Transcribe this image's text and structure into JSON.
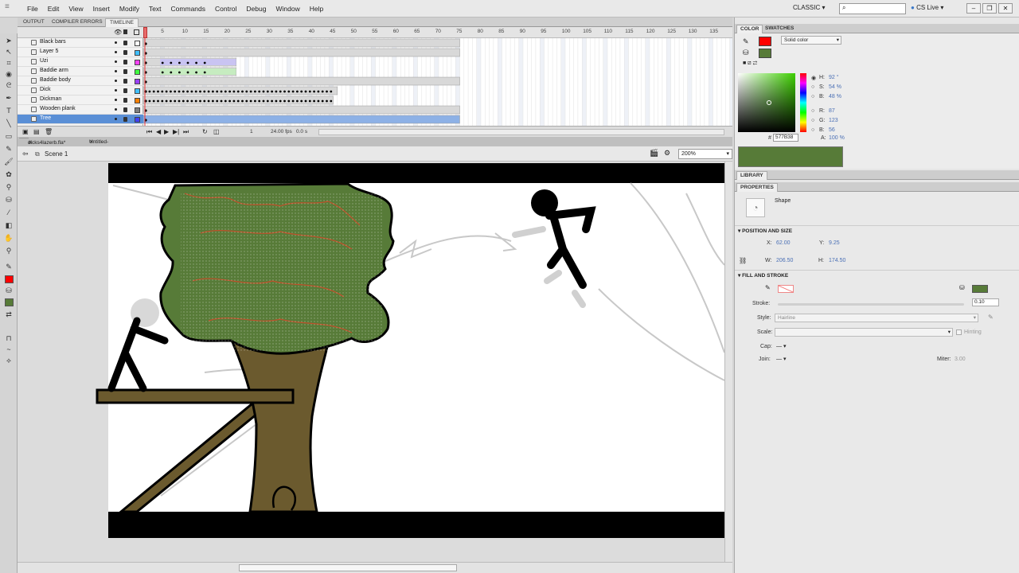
{
  "menu": {
    "items": [
      "File",
      "Edit",
      "View",
      "Insert",
      "Modify",
      "Text",
      "Commands",
      "Control",
      "Debug",
      "Window",
      "Help"
    ]
  },
  "workspace": "CLASSIC",
  "cs_live": "CS Live",
  "timeline_tabs": [
    "OUTPUT",
    "COMPILER ERRORS",
    "TIMELINE"
  ],
  "frame_numbers": [
    "1",
    "5",
    "10",
    "15",
    "20",
    "25",
    "30",
    "35",
    "40",
    "45",
    "50",
    "55",
    "60",
    "65",
    "70",
    "75",
    "80",
    "85",
    "90",
    "95",
    "100",
    "105",
    "110",
    "115",
    "120",
    "125",
    "130",
    "135"
  ],
  "layers": [
    {
      "name": "Black bars",
      "color": "#ffffff"
    },
    {
      "name": "Layer 5",
      "color": "#40c0ff"
    },
    {
      "name": "Uzi",
      "color": "#ff40ff"
    },
    {
      "name": "Baddie arm",
      "color": "#40ff40"
    },
    {
      "name": "Baddie body",
      "color": "#9a40ff"
    },
    {
      "name": "Dick",
      "color": "#40c0ff"
    },
    {
      "name": "Dickman",
      "color": "#ff8000"
    },
    {
      "name": "Wooden plank",
      "color": "#808080"
    },
    {
      "name": "Tree",
      "color": "#4040ff"
    }
  ],
  "timeline_footer": {
    "fps": "24.00 fps",
    "time": "0.0 s",
    "frame": "1"
  },
  "doc_tabs": [
    "dicks4lazerb.fla*",
    "Untitled-1*"
  ],
  "scene": "Scene 1",
  "zoom": "200%",
  "color_panel": {
    "tabs": [
      "COLOR",
      "SWATCHES"
    ],
    "type": "Solid color",
    "stroke_color": "#ff0000",
    "fill_color": "#577b38",
    "hue_label": "H:",
    "hue": "92 °",
    "sat_label": "S:",
    "sat": "54 %",
    "bri_label": "B:",
    "bri": "48 %",
    "r_label": "R:",
    "r": "87",
    "g_label": "G:",
    "g": "123",
    "b_label": "B:",
    "b": "56",
    "hex_label": "#",
    "hex": "577B38",
    "alpha_label": "A:",
    "alpha": "100 %"
  },
  "library_tab": "LIBRARY",
  "properties": {
    "tab": "PROPERTIES",
    "type": "Shape",
    "pos_section": "POSITION AND SIZE",
    "x_label": "X:",
    "x": "62.00",
    "y_label": "Y:",
    "y": "9.25",
    "w_label": "W:",
    "w": "206.50",
    "h_label": "H:",
    "h": "174.50",
    "fill_section": "FILL AND STROKE",
    "stroke_label": "Stroke:",
    "stroke": "0.10",
    "style_label": "Style:",
    "style": "Hairline",
    "scale_label": "Scale:",
    "hinting": "Hinting",
    "cap_label": "Cap:",
    "join_label": "Join:",
    "miter_label": "Miter:",
    "miter": "3.00"
  },
  "colors": {
    "fill_green": "#577b38",
    "tree_trunk": "#6b5a2e",
    "layer_select": "#5a8fd6"
  }
}
